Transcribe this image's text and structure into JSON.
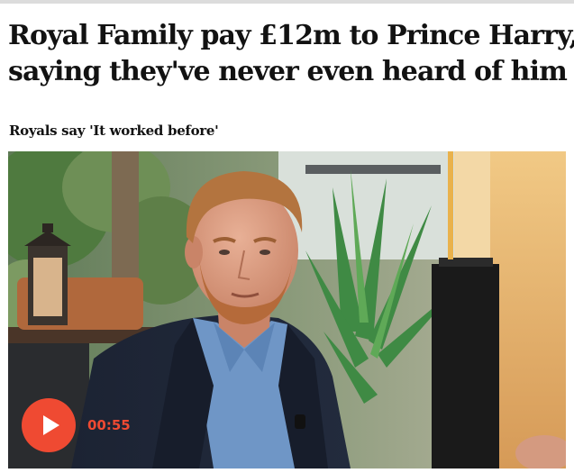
{
  "article": {
    "headline_lines": [
      "Royal Family pay £12m to Prince Harry,",
      "saying they've never even heard of him"
    ],
    "standfirst": "Royals say 'It worked before'"
  },
  "video": {
    "duration": "00:55",
    "play_icon": "play-icon",
    "accent_color": "#ef4a32"
  }
}
